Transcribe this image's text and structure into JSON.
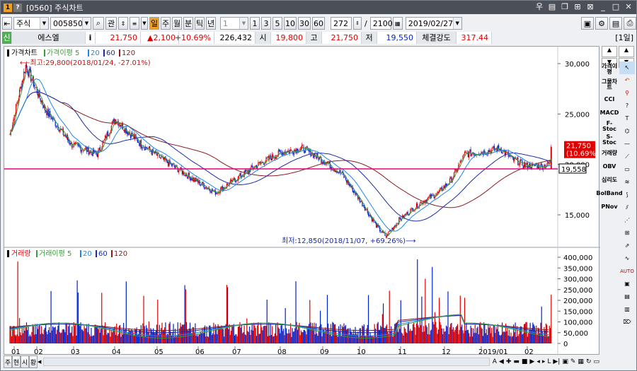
{
  "title": {
    "code": "[0560]",
    "name": "주식차트"
  },
  "toolbar1": {
    "market": "주식",
    "code": "005850",
    "btn_gwan": "관",
    "periods": [
      "주",
      "월",
      "분",
      "틱",
      "년"
    ],
    "interval_value": "1",
    "nums": [
      "1",
      "3",
      "5",
      "10",
      "30",
      "60"
    ],
    "count_value": "272",
    "total_value": "2100",
    "date_value": "2019/02/27"
  },
  "quote": {
    "tag": "신",
    "name": "에스엘",
    "info": "i",
    "price": "21,750",
    "change": "▲2,100",
    "rate": "+10.69%",
    "volume": "226,432",
    "open_label": "시",
    "open": "19,800",
    "high_label": "고",
    "high": "21,750",
    "low_label": "저",
    "low": "19,550",
    "strength_label": "체결강도",
    "strength": "317.44",
    "period_badge": "[1일]"
  },
  "price_legend": {
    "title": "가격차트",
    "ma_label": "가격이평",
    "ma": [
      "5",
      "20",
      "60",
      "120"
    ]
  },
  "annotations": {
    "high": "최고:29,800(2018/01/24, -27.01%)",
    "low": "최저:12,850(2018/11/07, +69.26%)",
    "last_price": "21,750",
    "last_rate": "(10.69%)",
    "hline_value": "19,558"
  },
  "price_axis": [
    "30,000",
    "25,000",
    "20,000",
    "15,000"
  ],
  "volume_legend": {
    "title": "거래량",
    "ma_label": "거래이평",
    "ma": [
      "5",
      "20",
      "60",
      "120"
    ]
  },
  "volume_axis": [
    "400,000",
    "350,000",
    "300,000",
    "250,000",
    "200,000",
    "150,000",
    "100,000",
    "50,000",
    "0"
  ],
  "month_axis": [
    "01",
    "02",
    "03",
    "04",
    "05",
    "06",
    "07",
    "08",
    "09",
    "10",
    "11",
    "12",
    "2019/01",
    "02"
  ],
  "bottom_tabs": [
    "주",
    "현",
    "시",
    "황"
  ],
  "side_indicators": [
    "가격이평",
    "그물차트",
    "CCI",
    "MACD",
    "F-Stoc",
    "S-Stoc",
    "거래량",
    "OBV",
    "심리도",
    "BolBand",
    "PNov"
  ],
  "colors": {
    "ma5": "#3a9d3a",
    "ma20": "#1e88e5",
    "ma60": "#1a2aa8",
    "ma120": "#8b1a1a",
    "up": "#e00000",
    "down": "#0024d0",
    "hline": "#e6007e"
  },
  "chart_data": {
    "type": "candlestick",
    "series_note": "",
    "price_ylim": [
      12850,
      30000
    ],
    "reference_line": 19558,
    "key_points": [
      {
        "date": "2018/01/24",
        "price": 29800,
        "label": "최고"
      },
      {
        "date": "2018/11/07",
        "price": 12850,
        "label": "최저"
      },
      {
        "date": "2019/02/27",
        "price": 21750
      }
    ],
    "monthly_close_approx": {
      "x": [
        "01",
        "02",
        "03",
        "04",
        "05",
        "06",
        "07",
        "08",
        "09",
        "10",
        "11",
        "12",
        "2019/01",
        "02"
      ],
      "values": [
        26500,
        24500,
        22500,
        23500,
        21500,
        19200,
        18500,
        19800,
        21000,
        18500,
        14000,
        17000,
        21000,
        20000
      ]
    },
    "volume_ylim": [
      0,
      420000
    ]
  }
}
